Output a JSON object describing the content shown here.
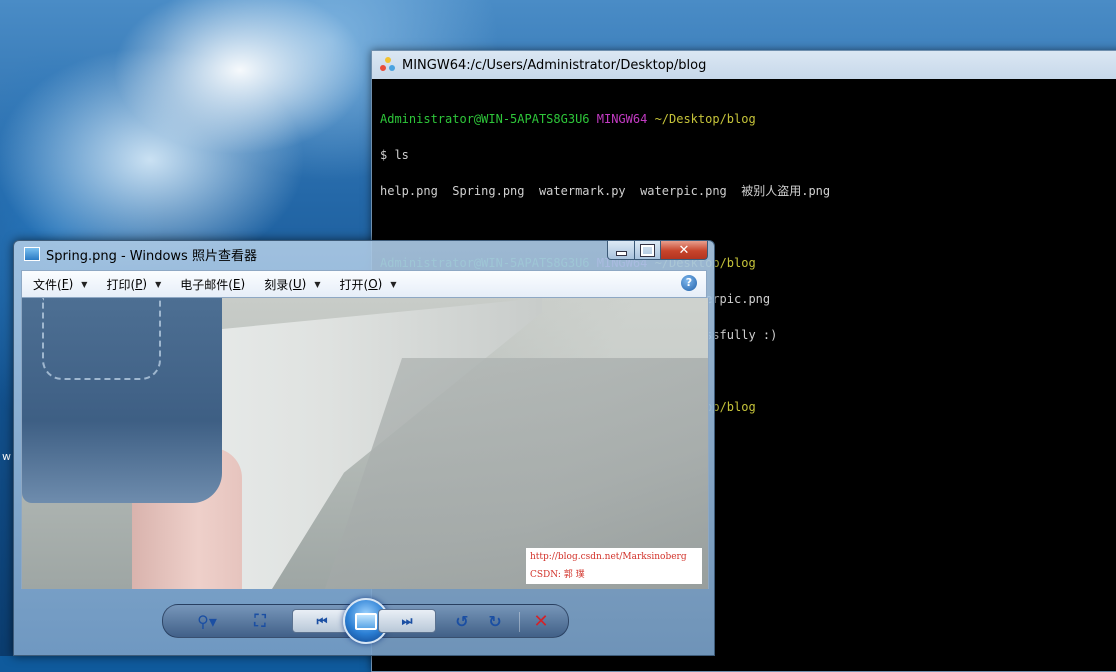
{
  "desktop": {
    "edge_label": "w"
  },
  "terminal": {
    "title": "MINGW64:/c/Users/Administrator/Desktop/blog",
    "prompt": {
      "user_host": "Administrator@WIN-5APATS8G3U6",
      "shell": "MINGW64",
      "path": "~/Desktop/blog"
    },
    "blocks": [
      {
        "command": "$ ls",
        "output": "help.png  Spring.png  watermark.py  waterpic.png  被别人盗用.png"
      },
      {
        "command": "$ python watermark.py -spp Spring.png -mp waterpic.png",
        "output": "Spring.png has beed added the watermark successfully :)"
      }
    ],
    "final_prompt_symbol": "$"
  },
  "viewer": {
    "title": "Spring.png - Windows 照片查看器",
    "menu": [
      {
        "label": "文件(",
        "key": "F",
        "suffix": ")"
      },
      {
        "label": "打印(",
        "key": "P",
        "suffix": ")"
      },
      {
        "label": "电子邮件(",
        "key": "E",
        "suffix": ")"
      },
      {
        "label": "刻录(",
        "key": "U",
        "suffix": ")"
      },
      {
        "label": "打开(",
        "key": "O",
        "suffix": ")"
      }
    ],
    "help_symbol": "?",
    "watermark": {
      "line1": "http://blog.csdn.net/Marksinoberg",
      "line2": "CSDN: 郭 璞"
    },
    "window_buttons": {
      "close": "✕"
    },
    "controls": {
      "zoom": "⚲▾",
      "actual_size": "⛶",
      "prev": "⏮",
      "next": "⏭",
      "rotate_ccw": "↺",
      "rotate_cw": "↻",
      "delete": "✕"
    }
  },
  "colors": {
    "terminal_green": "#2ec63a",
    "terminal_magenta": "#c33bc3",
    "terminal_yellow": "#c6c43a",
    "watermark_red": "#d2322a"
  }
}
